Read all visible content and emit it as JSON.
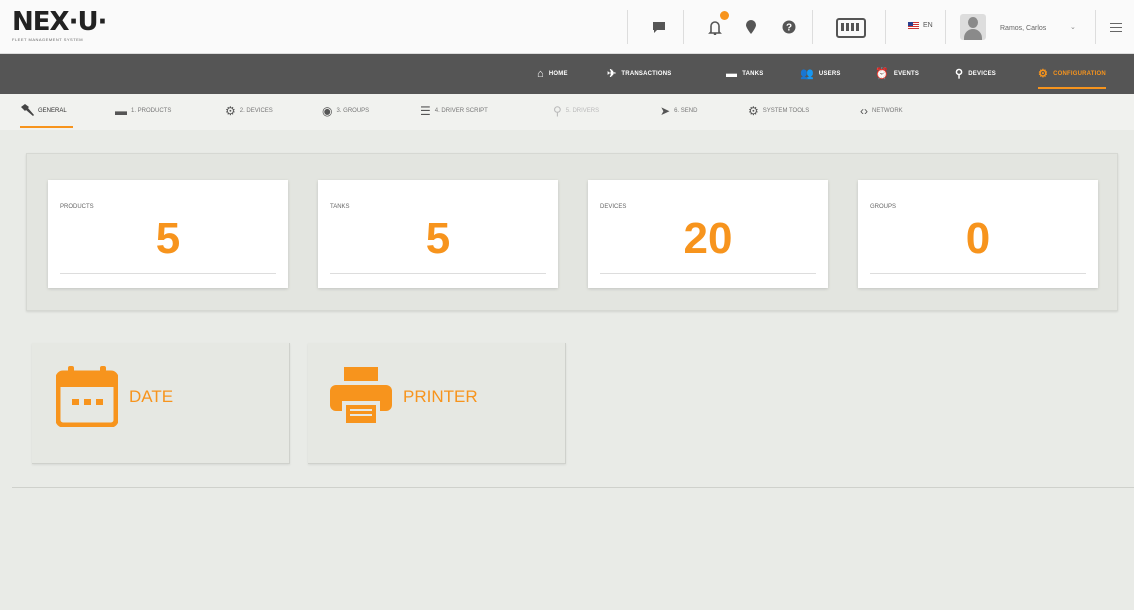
{
  "header": {
    "logo_text": "NEX·U·",
    "logo_sub": "FLEET MANAGEMENT SYSTEM",
    "icons": [
      "chat-icon",
      "notifications-icon",
      "location-pin-icon",
      "help-icon",
      "keyboard-icon",
      "menu-icon"
    ],
    "language": "EN",
    "user_name": "Ramos, Carlos",
    "user_caret": "⌄"
  },
  "main_nav": [
    {
      "label": "HOME",
      "icon": "home-icon",
      "glyph": "⌂"
    },
    {
      "label": "TRANSACTIONS",
      "icon": "plane-icon",
      "glyph": "✈"
    },
    {
      "label": "TANKS",
      "icon": "tank-icon",
      "glyph": "▬"
    },
    {
      "label": "USERS",
      "icon": "users-icon",
      "glyph": "👥"
    },
    {
      "label": "EVENTS",
      "icon": "alarm-icon",
      "glyph": "⏰"
    },
    {
      "label": "DEVICES",
      "icon": "device-icon",
      "glyph": "⚲"
    },
    {
      "label": "CONFIGURATION",
      "icon": "gear-icon",
      "glyph": "⚙"
    }
  ],
  "sub_nav": [
    {
      "label": "GENERAL",
      "icon": "wrench-icon",
      "glyph": "🔧"
    },
    {
      "label": "1. PRODUCTS",
      "icon": "product-icon",
      "glyph": "▬"
    },
    {
      "label": "2. DEVICES",
      "icon": "devices-icon",
      "glyph": "⚙"
    },
    {
      "label": "3. GROUPS",
      "icon": "groups-icon",
      "glyph": "◉"
    },
    {
      "label": "4. DRIVER SCRIPT",
      "icon": "script-icon",
      "glyph": "☰"
    },
    {
      "label": "5. DRIVERS",
      "icon": "drivers-icon",
      "glyph": "⚲"
    },
    {
      "label": "6. SEND",
      "icon": "send-icon",
      "glyph": "➤"
    },
    {
      "label": "SYSTEM TOOLS",
      "icon": "tools-gear-icon",
      "glyph": "⚙"
    },
    {
      "label": "NETWORK",
      "icon": "network-icon",
      "glyph": "‹›"
    }
  ],
  "stats": [
    {
      "label": "PRODUCTS",
      "value": "5"
    },
    {
      "label": "TANKS",
      "value": "5"
    },
    {
      "label": "DEVICES",
      "value": "20"
    },
    {
      "label": "GROUPS",
      "value": "0"
    }
  ],
  "tiles": [
    {
      "label": "DATE",
      "icon": "calendar-icon"
    },
    {
      "label": "PRINTER",
      "icon": "printer-icon"
    }
  ],
  "colors": {
    "accent": "#f7941d",
    "nav_bg": "#555555",
    "background": "#e9ebe7"
  }
}
